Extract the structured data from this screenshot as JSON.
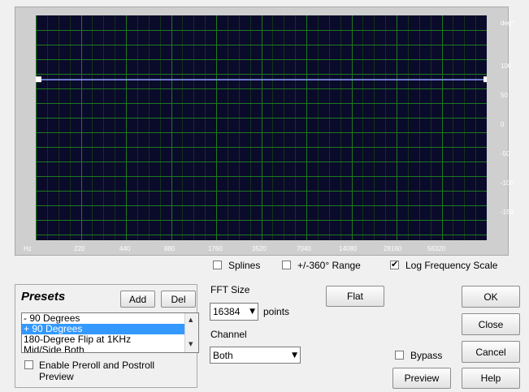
{
  "graph": {
    "y_unit": "deg°",
    "y_ticks": [
      "100",
      "50",
      "0",
      "-50",
      "-100",
      "-150"
    ],
    "x_ticks": [
      "Hz",
      "220",
      "440",
      "880",
      "1760",
      "3520",
      "7040",
      "14080",
      "28160",
      "56320"
    ],
    "phase_value_deg": 90,
    "colors": {
      "background": "#0a0a2a",
      "grid": "#1e7a1e",
      "curve": "#8a9fff"
    }
  },
  "options": {
    "splines_label": "Splines",
    "splines_checked": false,
    "range_label": "+/-360° Range",
    "range_checked": false,
    "log_label": "Log Frequency Scale",
    "log_checked": true
  },
  "presets": {
    "title": "Presets",
    "add_label": "Add",
    "del_label": "Del",
    "items": [
      "- 90 Degrees",
      "+ 90 Degrees",
      "180-Degree Flip at 1KHz",
      "Mid/Side Both"
    ],
    "selected_index": 1,
    "enable_label_line1": "Enable Preroll and Postroll",
    "enable_label_line2": "Preview",
    "enable_checked": false
  },
  "fft": {
    "label": "FFT Size",
    "value": "16384",
    "unit": "points"
  },
  "channel": {
    "label": "Channel",
    "value": "Both"
  },
  "buttons": {
    "flat": "Flat",
    "ok": "OK",
    "close": "Close",
    "cancel": "Cancel",
    "help": "Help",
    "preview": "Preview"
  },
  "bypass": {
    "label": "Bypass",
    "checked": false
  }
}
